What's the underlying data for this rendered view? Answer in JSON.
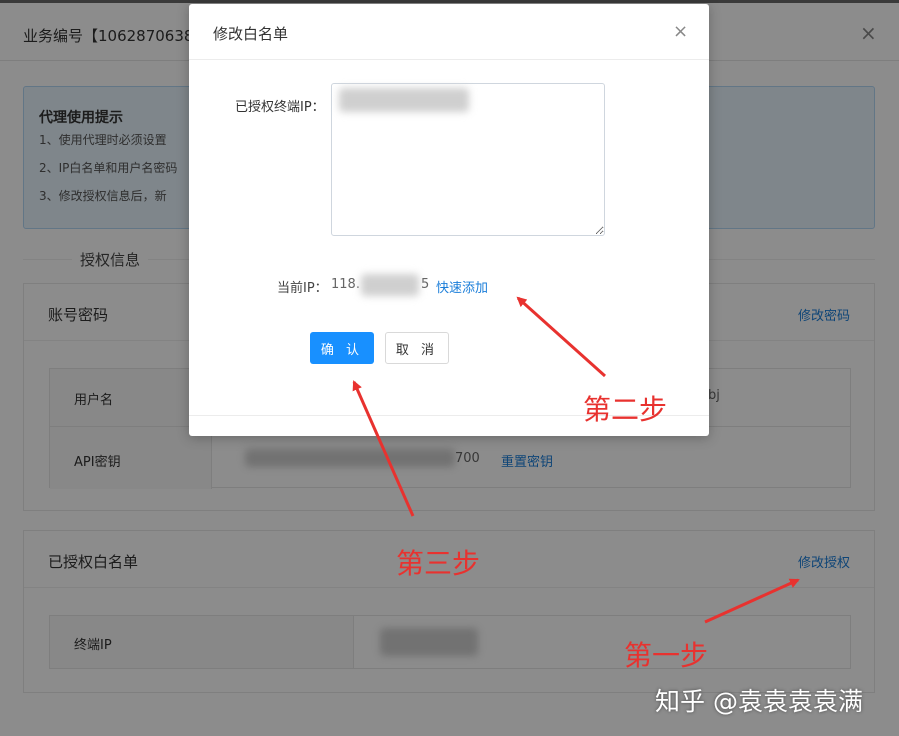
{
  "background_dialog": {
    "title": "业务编号【1062870638",
    "close": "×",
    "tip": {
      "title": "代理使用提示",
      "lines": [
        "1、使用代理时必须设置",
        "2、IP白名单和用户名密码",
        "3、修改授权信息后，新"
      ]
    },
    "section_label": "授权信息",
    "account_card": {
      "title": "账号密码",
      "link": "修改密码",
      "rows": [
        {
          "key": "用户名",
          "value_tail": "bj"
        },
        {
          "key": "API密钥",
          "value_tail": "700",
          "action": "重置密钥"
        }
      ]
    },
    "whitelist_card": {
      "title": "已授权白名单",
      "link": "修改授权",
      "rows": [
        {
          "key": "终端IP"
        }
      ]
    }
  },
  "modal": {
    "title": "修改白名单",
    "close": "×",
    "field_label": "已授权终端IP：",
    "current_ip_label": "当前IP：",
    "current_ip_prefix": "118.",
    "current_ip_suffix": "5",
    "quick_add": "快速添加",
    "confirm": "确 认",
    "cancel": "取 消"
  },
  "annotations": {
    "step1": "第一步",
    "step2": "第二步",
    "step3": "第三步",
    "color": "#e8322f"
  },
  "watermark": "知乎 @袁袁袁袁满",
  "colors": {
    "primary": "#1890ff",
    "link": "#1b7ed9",
    "tip_bg": "#e8f4fd"
  }
}
